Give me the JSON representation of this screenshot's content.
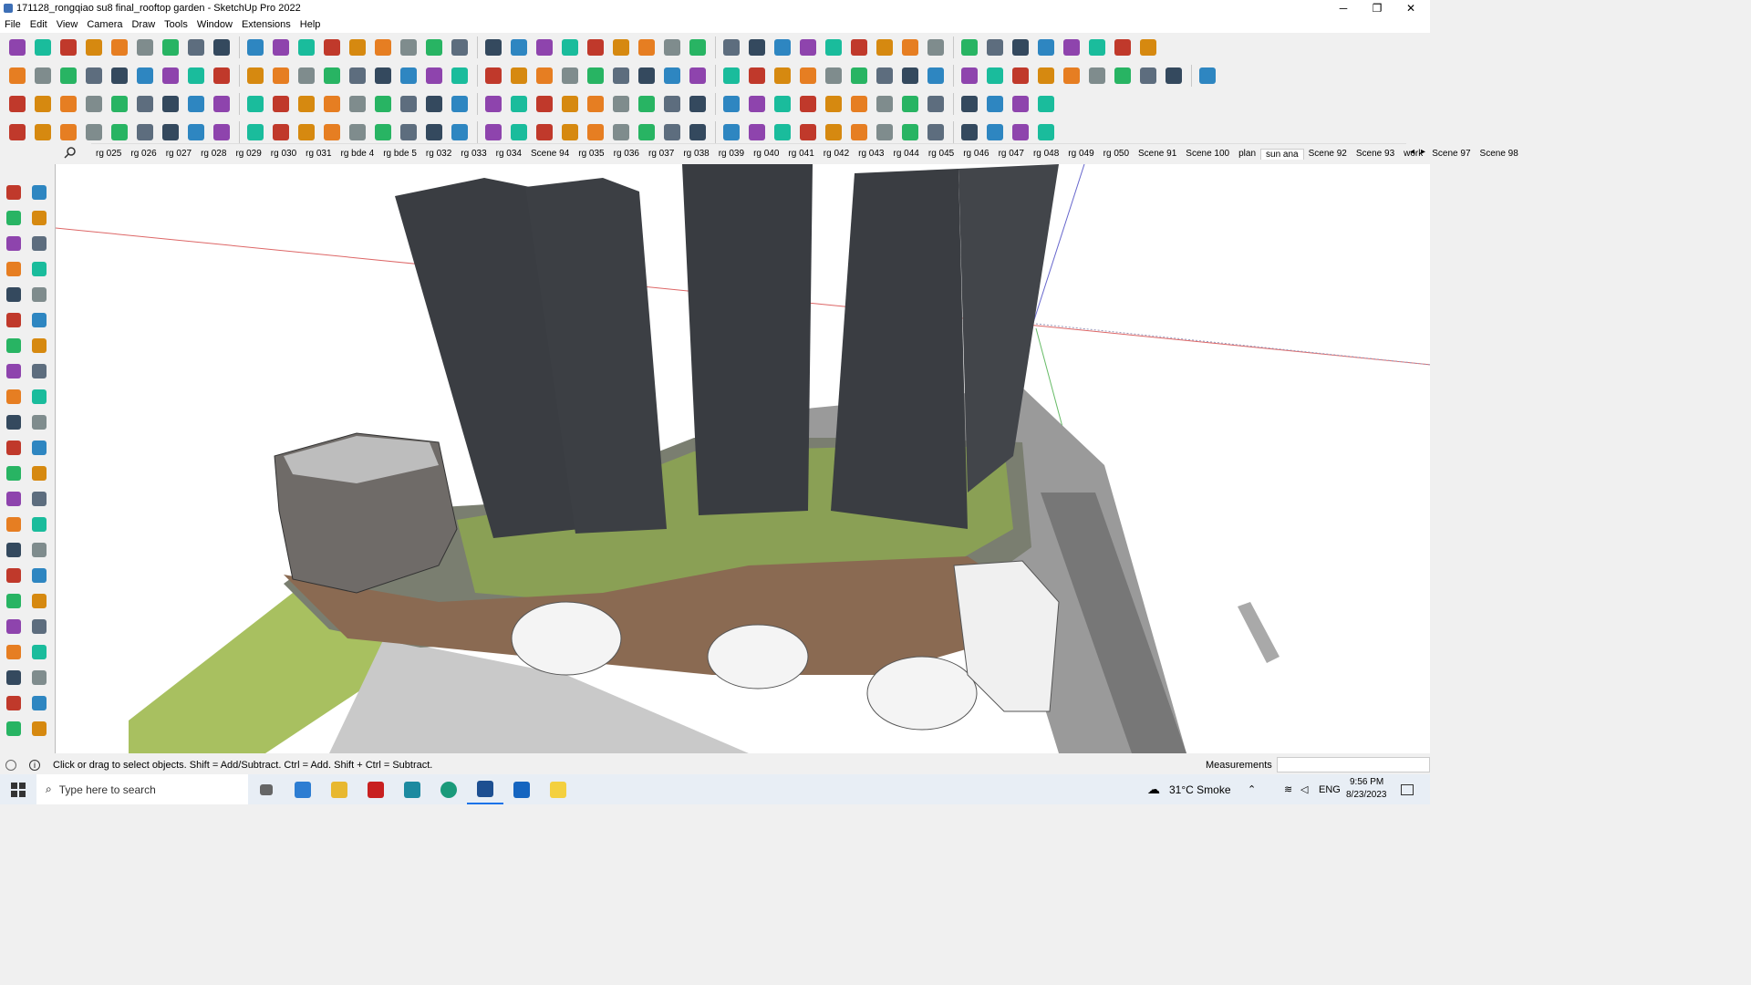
{
  "window": {
    "title": "171128_rongqiao su8 final_rooftop garden - SketchUp Pro 2022",
    "minimize": "─",
    "restore": "❐",
    "close": "✕"
  },
  "menu": [
    "File",
    "Edit",
    "View",
    "Camera",
    "Draw",
    "Tools",
    "Window",
    "Extensions",
    "Help"
  ],
  "scenes": {
    "search_icon": "search-icon",
    "tabs": [
      "rg 025",
      "rg 026",
      "rg 027",
      "rg 028",
      "rg 029",
      "rg 030",
      "rg 031",
      "rg bde 4",
      "rg bde 5",
      "rg 032",
      "rg 033",
      "rg 034",
      "Scene 94",
      "rg 035",
      "rg 036",
      "rg 037",
      "rg 038",
      "rg 039",
      "rg 040",
      "rg 041",
      "rg 042",
      "rg 043",
      "rg 044",
      "rg 045",
      "rg 046",
      "rg 047",
      "rg 048",
      "rg 049",
      "rg 050",
      "Scene 91",
      "Scene 100",
      "plan",
      "sun ana",
      "Scene 92",
      "Scene 93",
      "work",
      "Scene 97",
      "Scene 98"
    ],
    "active": "sun ana",
    "prev": "◂",
    "next": "▸"
  },
  "status": {
    "hint": "Click or drag to select objects. Shift = Add/Subtract. Ctrl = Add. Shift + Ctrl = Subtract.",
    "measurements_label": "Measurements",
    "measurements_value": ""
  },
  "taskbar": {
    "search_placeholder": "Type here to search",
    "weather": "31°C  Smoke",
    "lang": "ENG",
    "time": "9:56 PM",
    "date": "8/23/2023"
  },
  "colors": {
    "viewport_bg": "#ffffff",
    "tower": "#3a3d42",
    "garden": "#8aa055",
    "deck": "#8a6a52",
    "taskbar": "#e8eef5"
  }
}
